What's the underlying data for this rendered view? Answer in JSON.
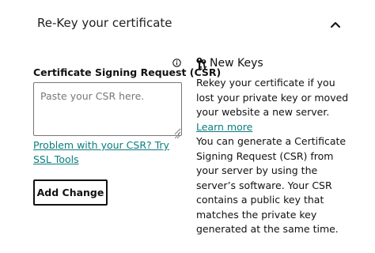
{
  "section": {
    "title": "Re-Key your certificate",
    "collapse_icon": "chevron-up-icon"
  },
  "form": {
    "label": "Certificate Signing Request (CSR)",
    "info_icon": "info-icon",
    "textarea_placeholder": "Paste your CSR here.",
    "textarea_value": "",
    "help_link": "Problem with your CSR? Try SSL Tools",
    "submit_label": "Add Change"
  },
  "info": {
    "icon": "keys-icon",
    "heading": "New Keys",
    "para1_text": "Rekey your certificate if you lost your private key or moved your website a new server.",
    "learn_more": "Learn more",
    "para2_text": "You can generate a Certificate Signing Request (CSR) from your server by using the server’s software. Your CSR contains a public key that matches the private key generated at the same time."
  },
  "colors": {
    "link": "#0a7d7f",
    "text": "#111111",
    "border": "#767676"
  }
}
